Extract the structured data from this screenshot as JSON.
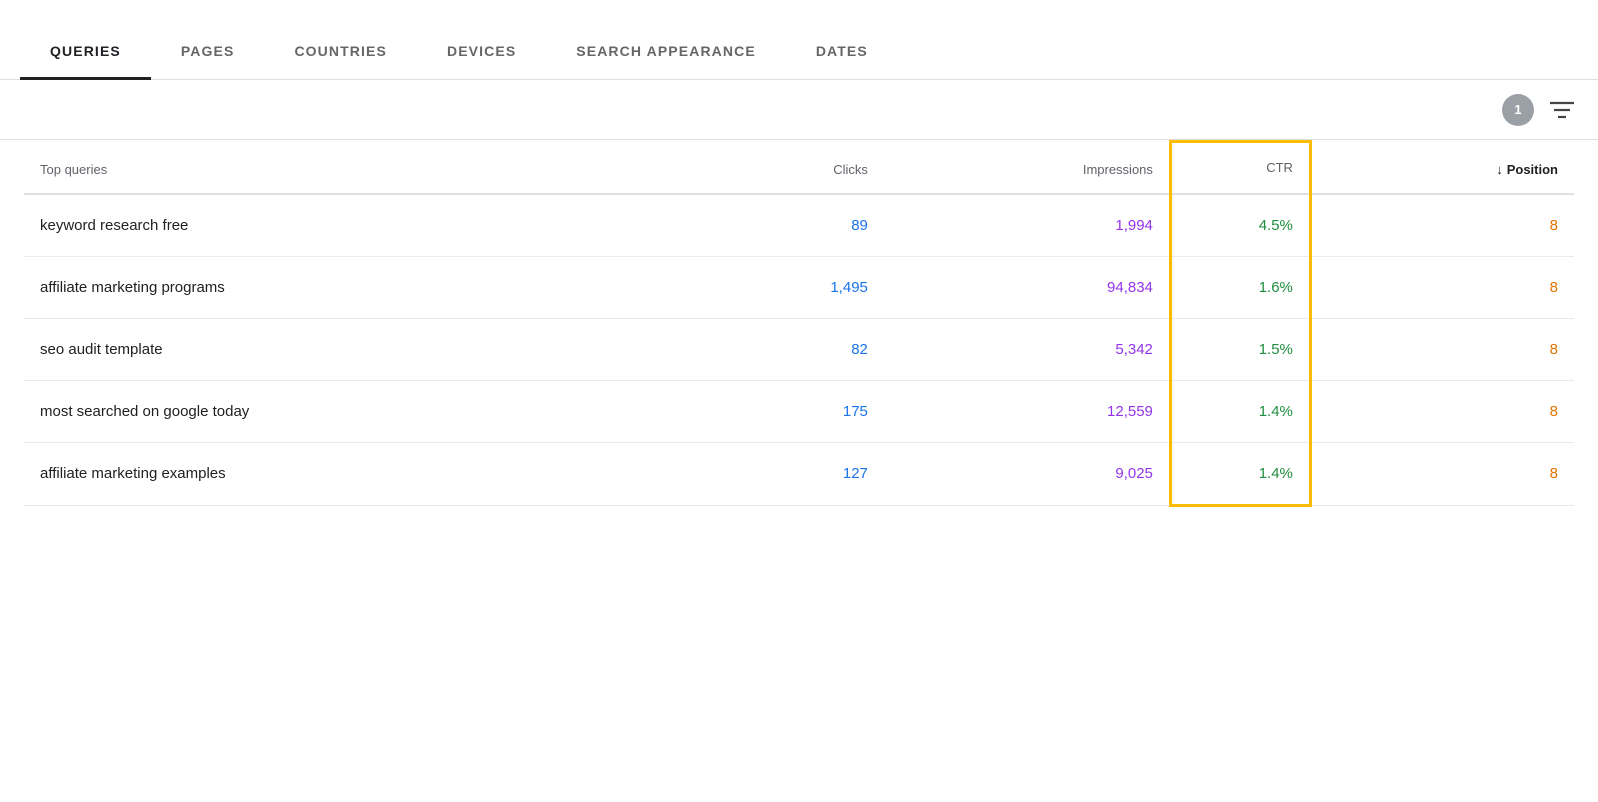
{
  "tabs": [
    {
      "id": "queries",
      "label": "QUERIES",
      "active": true
    },
    {
      "id": "pages",
      "label": "PAGES",
      "active": false
    },
    {
      "id": "countries",
      "label": "COUNTRIES",
      "active": false
    },
    {
      "id": "devices",
      "label": "DEVICES",
      "active": false
    },
    {
      "id": "search-appearance",
      "label": "SEARCH APPEARANCE",
      "active": false
    },
    {
      "id": "dates",
      "label": "DATES",
      "active": false
    }
  ],
  "toolbar": {
    "filter_count": "1",
    "filter_icon": "≡"
  },
  "table": {
    "columns": {
      "query": "Top queries",
      "clicks": "Clicks",
      "impressions": "Impressions",
      "ctr": "CTR",
      "position": "Position"
    },
    "rows": [
      {
        "query": "keyword research free",
        "clicks": "89",
        "impressions": "1,994",
        "ctr": "4.5%",
        "position": "8"
      },
      {
        "query": "affiliate marketing programs",
        "clicks": "1,495",
        "impressions": "94,834",
        "ctr": "1.6%",
        "position": "8"
      },
      {
        "query": "seo audit template",
        "clicks": "82",
        "impressions": "5,342",
        "ctr": "1.5%",
        "position": "8"
      },
      {
        "query": "most searched on google today",
        "clicks": "175",
        "impressions": "12,559",
        "ctr": "1.4%",
        "position": "8"
      },
      {
        "query": "affiliate marketing examples",
        "clicks": "127",
        "impressions": "9,025",
        "ctr": "1.4%",
        "position": "8"
      }
    ]
  }
}
